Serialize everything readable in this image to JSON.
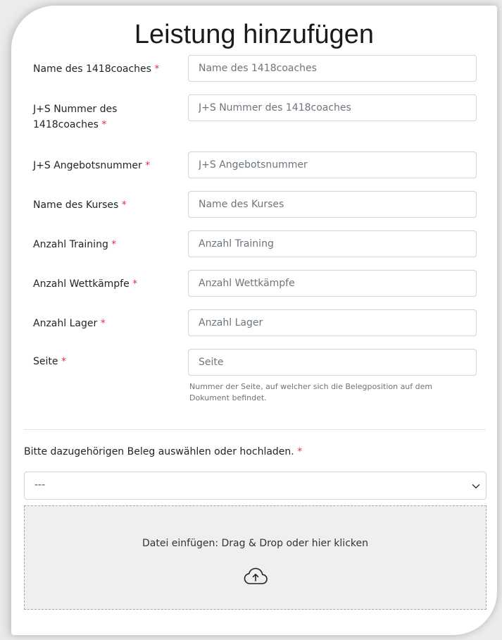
{
  "title": "Leistung hinzufügen",
  "required_marker": "*",
  "fields": [
    {
      "label": "Name des 1418coaches",
      "placeholder": "Name des 1418coaches"
    },
    {
      "label": "J+S Nummer des 1418coaches",
      "placeholder": "J+S Nummer des 1418coaches"
    },
    {
      "label": "J+S Angebotsnummer",
      "placeholder": "J+S Angebotsnummer"
    },
    {
      "label": "Name des Kurses",
      "placeholder": "Name des Kurses"
    },
    {
      "label": "Anzahl Training",
      "placeholder": "Anzahl Training"
    },
    {
      "label": "Anzahl Wettkämpfe",
      "placeholder": "Anzahl Wettkämpfe"
    },
    {
      "label": "Anzahl Lager",
      "placeholder": "Anzahl Lager"
    },
    {
      "label": "Seite",
      "placeholder": "Seite",
      "help": "Nummer der Seite, auf welcher sich die Belegposition auf dem Dokument befindet."
    }
  ],
  "beleg": {
    "label": "Bitte dazugehörigen Beleg auswählen oder hochladen.",
    "selected": "---"
  },
  "dropzone": {
    "text": "Datei einfügen: Drag & Drop oder hier klicken",
    "icon": "cloud-upload-icon"
  },
  "colors": {
    "required": "#dc3545",
    "border": "#ced4da",
    "dropzone_bg": "#efefef"
  }
}
